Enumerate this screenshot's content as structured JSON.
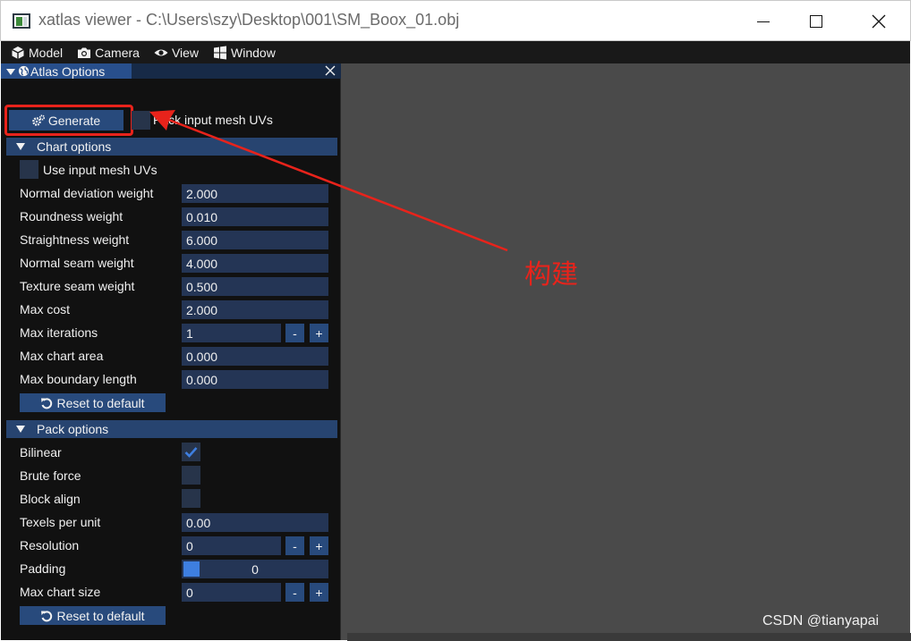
{
  "window": {
    "title": "xatlas viewer - C:\\Users\\szy\\Desktop\\001\\SM_Boox_01.obj"
  },
  "menu": {
    "items": [
      {
        "label": "Model",
        "icon": "cube-icon"
      },
      {
        "label": "Camera",
        "icon": "camera-icon"
      },
      {
        "label": "View",
        "icon": "eye-icon"
      },
      {
        "label": "Window",
        "icon": "windows-icon"
      }
    ]
  },
  "panel": {
    "title": "Atlas Options",
    "generate_label": "Generate",
    "pack_input_uvs_label": "Pack input mesh UVs",
    "pack_input_uvs_checked": false,
    "chart_section": {
      "title": "Chart options",
      "use_input_uvs_label": "Use input mesh UVs",
      "use_input_uvs_checked": false,
      "rows": [
        {
          "label": "Normal deviation weight",
          "value": "2.000"
        },
        {
          "label": "Roundness weight",
          "value": "0.010"
        },
        {
          "label": "Straightness weight",
          "value": "6.000"
        },
        {
          "label": "Normal seam weight",
          "value": "4.000"
        },
        {
          "label": "Texture seam weight",
          "value": "0.500"
        },
        {
          "label": "Max cost",
          "value": "2.000"
        },
        {
          "label": "Max iterations",
          "value": "1"
        },
        {
          "label": "Max chart area",
          "value": "0.000"
        },
        {
          "label": "Max boundary length",
          "value": "0.000"
        }
      ],
      "reset_label": "Reset to default"
    },
    "pack_section": {
      "title": "Pack options",
      "bilinear_label": "Bilinear",
      "bilinear_checked": true,
      "brute_force_label": "Brute force",
      "brute_force_checked": false,
      "block_align_label": "Block align",
      "block_align_checked": false,
      "texels_label": "Texels per unit",
      "texels_value": "0.00",
      "resolution_label": "Resolution",
      "resolution_value": "0",
      "padding_label": "Padding",
      "padding_value": "0",
      "max_chart_size_label": "Max chart size",
      "max_chart_size_value": "0",
      "reset_label": "Reset to default"
    },
    "stepper_minus": "-",
    "stepper_plus": "+"
  },
  "annotation": {
    "text": "构建",
    "color": "#e8231b"
  },
  "watermark": "CSDN @tianyapai",
  "colors": {
    "panel_bg": "#111111",
    "header_active": "#284f8c",
    "button": "#284a7c",
    "field": "#243555",
    "accent_check": "#3e7fe0",
    "viewport": "#4a4a4a"
  }
}
